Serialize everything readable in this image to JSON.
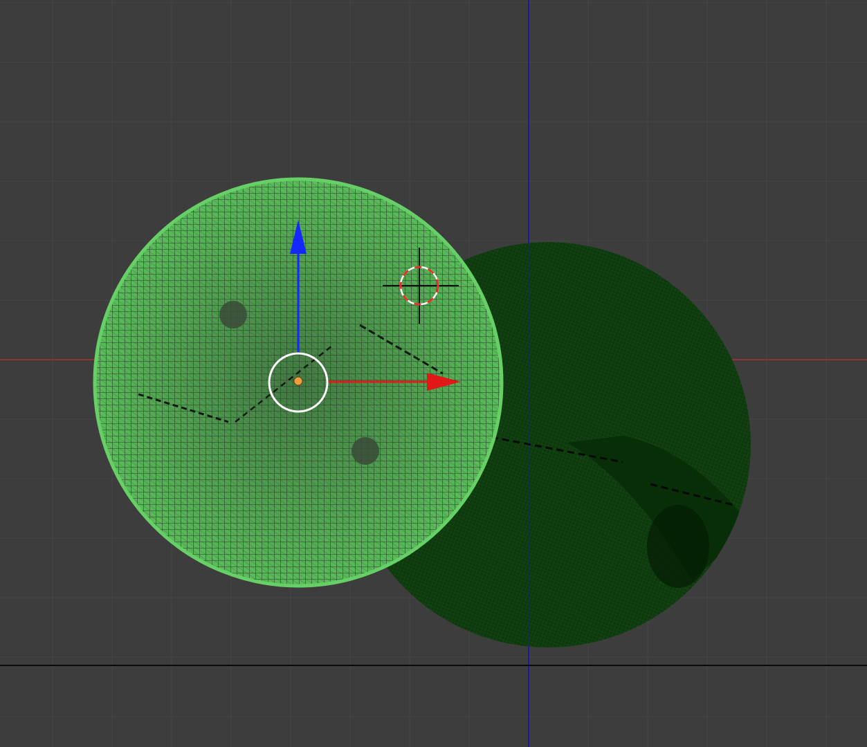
{
  "viewport": {
    "background": "#3d3d3d",
    "grid_color": "#454545",
    "x_axis_color": "#b02828",
    "z_axis_color": "#1a1a9e",
    "bottom_line_color": "#0a0a0a"
  },
  "objects": [
    {
      "kind": "wireframe-sphere",
      "state": "selected",
      "fill": "#5cc45c",
      "wire_color": "#2a3a2a"
    },
    {
      "kind": "wireframe-sphere",
      "state": "unselected",
      "fill": "#0b3a0b",
      "wire_color": "#2e4a2e"
    }
  ],
  "gizmo": {
    "x_axis_color": "#e01818",
    "z_axis_color": "#1428ff",
    "ring_color": "#ffffff",
    "origin_color": "#e8a040"
  },
  "cursor3d": {
    "ring_colors": [
      "#ff2020",
      "#ffffff"
    ],
    "crosshair_color": "#101010"
  }
}
